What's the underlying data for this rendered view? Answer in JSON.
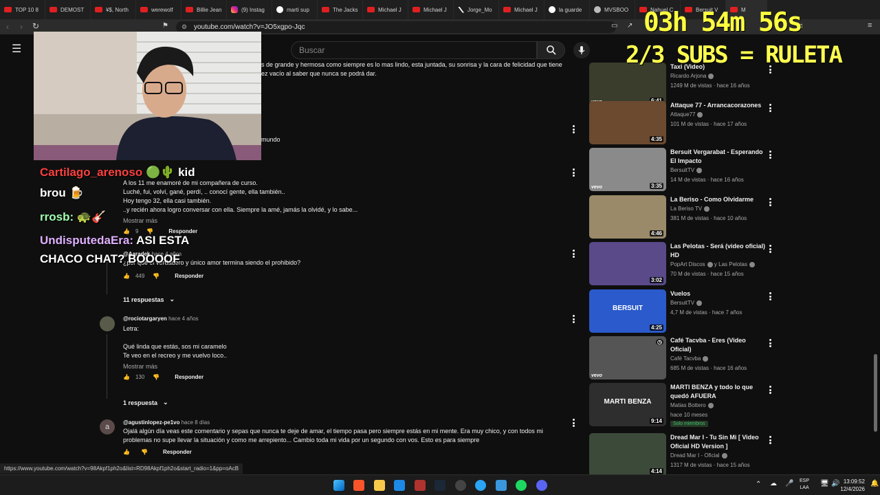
{
  "browser": {
    "tabs": [
      {
        "label": "TOP 10 8",
        "icon": "youtube-icon"
      },
      {
        "label": "DEMOST",
        "icon": "youtube-icon"
      },
      {
        "label": "¥$, North",
        "icon": "youtube-icon"
      },
      {
        "label": "werewolf",
        "icon": "youtube-icon"
      },
      {
        "label": "Billie Jean",
        "icon": "youtube-icon"
      },
      {
        "label": "(9) Instag",
        "icon": "instagram-icon"
      },
      {
        "label": "marti sup",
        "icon": "google-icon"
      },
      {
        "label": "The Jacks",
        "icon": "youtube-icon"
      },
      {
        "label": "Michael J",
        "icon": "youtube-icon"
      },
      {
        "label": "Michael J",
        "icon": "youtube-icon"
      },
      {
        "label": "Jorge_Mo",
        "icon": "x-icon"
      },
      {
        "label": "Michael J",
        "icon": "youtube-icon"
      },
      {
        "label": "la guarde",
        "icon": "google-icon"
      },
      {
        "label": "MVSBOO",
        "icon": "steam-icon"
      },
      {
        "label": "Nahuel C",
        "icon": "youtube-icon"
      },
      {
        "label": "Bersuit V",
        "icon": "youtube-icon"
      },
      {
        "label": "M",
        "icon": "youtube-icon"
      }
    ],
    "url": "youtube.com/watch?v=JO5xgpo-Jqc",
    "status_url": "https://www.youtube.com/watch?v=98Akpf1ph2o&list=RD98Akpf1ph2o&start_radio=1&pp=oAcB"
  },
  "youtube": {
    "search_placeholder": "Buscar",
    "top_comment_tail_1": "s de grande y hermosa como siempre es lo mas lindo, esta  juntada,  su sonrisa y la cara de felicidad que tiene",
    "top_comment_tail_2": "ez vacío al saber que nunca se podrá dar.",
    "mundo_fragment": "mundo",
    "comments": [
      {
        "lines": [
          "A los 11 me enamoré de mi compañera de curso.",
          "Luché, fui, volví, gané, perdí, .. conocí gente, ella también..",
          "Hoy tengo 32, ella casi también.",
          "..y recién ahora logro conversar con ella. Siempre la amé, jamás la olvidé, y lo sabe..."
        ],
        "more": "Mostrar más",
        "likes": "9",
        "reply": "Responder"
      },
      {
        "handle": "@Aaradek",
        "time": "hace 4 años",
        "lines": [
          "¿por qué el verdadero y único amor termina siendo el prohibido?"
        ],
        "likes": "449",
        "reply": "Responder",
        "replies": "11 respuestas"
      },
      {
        "handle": "@rociotargaryen",
        "time": "hace 4 años",
        "lines": [
          "Letra:",
          "",
          "Qué linda que estás, sos mi caramelo",
          "Te veo en el recreo y me vuelvo loco.."
        ],
        "more": "Mostrar más",
        "likes": "130",
        "reply": "Responder",
        "replies": "1 respuesta"
      },
      {
        "handle": "@agustinlopez-pe1vo",
        "time": "hace 8 días",
        "avatar_letter": "a",
        "lines": [
          "Ojalá algún día veas este comentario y sepas que nunca te deje de amar, el tiempo pasa pero siempre estás en mi mente. Era muy chico, y con todos mi",
          "problemas no supe llevar la situación y como me arrepiento... Cambio toda mi vida por un segundo con vos. Esto es para siempre"
        ],
        "reply": "Responder"
      }
    ],
    "related": [
      {
        "title": "Taxi (Video)",
        "channel": "Ricardo Arjona",
        "meta": "1249 M de vistas · hace 16 años",
        "duration": "6:41",
        "vevo": "vevo",
        "thumb_color": "#3a3d2c"
      },
      {
        "title": "Attaque 77 - Arrancacorazones",
        "channel": "Attaque77",
        "meta": "101 M de vistas · hace 17 años",
        "duration": "4:35",
        "vevo": "",
        "thumb_color": "#6b4a30"
      },
      {
        "title": "Bersuit Vergarabat - Esperando El Impacto",
        "channel": "BersuitTV",
        "meta": "14 M de vistas · hace 16 años",
        "duration": "3:35",
        "vevo": "vevo",
        "thumb_color": "#8a8a8a"
      },
      {
        "title": "La Beriso - Como Olvidarme",
        "channel": "La Beriso TV",
        "meta": "381 M de vistas · hace 10 años",
        "duration": "4:46",
        "vevo": "",
        "thumb_color": "#9a8a6a"
      },
      {
        "title": "Las Pelotas - Será (video oficial) HD",
        "channel": "PopArt Discos",
        "channel2": "y Las Pelotas",
        "meta": "70 M de vistas · hace 15 años",
        "duration": "3:02",
        "vevo": "",
        "thumb_color": "#5a4a8a"
      },
      {
        "title": "Vuelos",
        "channel": "BersuitTV",
        "meta": "4,7 M de vistas · hace 7 años",
        "duration": "4:25",
        "vevo": "",
        "thumb_color": "#2a5acb",
        "thumb_text": "BERSUIT"
      },
      {
        "title": "Café Tacvba - Eres (Video Oficial)",
        "channel": "Café Tacvba",
        "meta": "685 M de vistas · hace 16 años",
        "duration": "",
        "vevo": "vevo",
        "thumb_color": "#555555"
      },
      {
        "title": "MARTI BENZA y todo lo que quedó AFUERA",
        "channel": "Matias Bottero",
        "meta": "hace 10 meses",
        "duration": "9:14",
        "vevo": "",
        "thumb_color": "#2e2e2e",
        "badge": "Solo miembros",
        "thumb_text": "MARTI BENZA"
      },
      {
        "title": "Dread Mar I - Tu Sin Mi [ Video Oficial HD Version ]",
        "channel": "Dread Mar I - Oficial",
        "meta": "1317 M de vistas · hace 15 años",
        "duration": "4:14",
        "vevo": "",
        "thumb_color": "#3c4a3a"
      }
    ]
  },
  "overlay": {
    "timer": "03h 54m 56s",
    "subs": "2/3 SUBS = RULETA",
    "chat": [
      {
        "user": "Cartilago_arenoso",
        "msg": "kid",
        "color": "#ff4040"
      },
      {
        "user": "brou",
        "msg": "",
        "color": "#ffffff"
      },
      {
        "user": "rrosb:",
        "msg": "",
        "color": "#9fffb0"
      },
      {
        "user": "UndisputedaEra:",
        "msg": "ASI ESTA",
        "color": "#e0b0ff"
      },
      {
        "user": "",
        "msg": "CHACO CHAT? BOOOOF",
        "color": "#ffffff"
      }
    ]
  },
  "taskbar": {
    "lang_1": "ESP",
    "lang_2": "LAA",
    "time": "13:09:52",
    "date": "12/4/2026"
  }
}
